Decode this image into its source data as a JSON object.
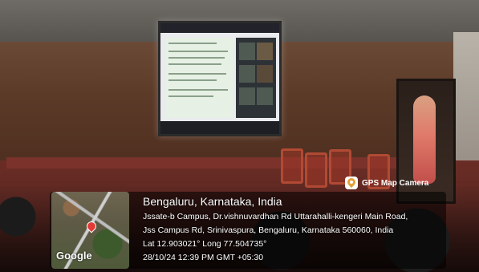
{
  "gps_overlay": {
    "badge_label": "GPS Map Camera",
    "title": "Bengaluru, Karnataka, India",
    "address_line_1": "Jssate-b Campus, Dr.vishnuvardhan Rd Uttarahalli-kengeri Main Road,",
    "address_line_2": "Jss Campus Rd, Srinivaspura, Bengaluru, Karnataka 560060, India",
    "coordinates": "Lat 12.903021° Long 77.504735°",
    "timestamp": "28/10/24 12:39 PM GMT +05:30",
    "map_attribution": "Google",
    "pin_color": "#e53935",
    "badge_icon": "gps-map-camera-icon"
  }
}
